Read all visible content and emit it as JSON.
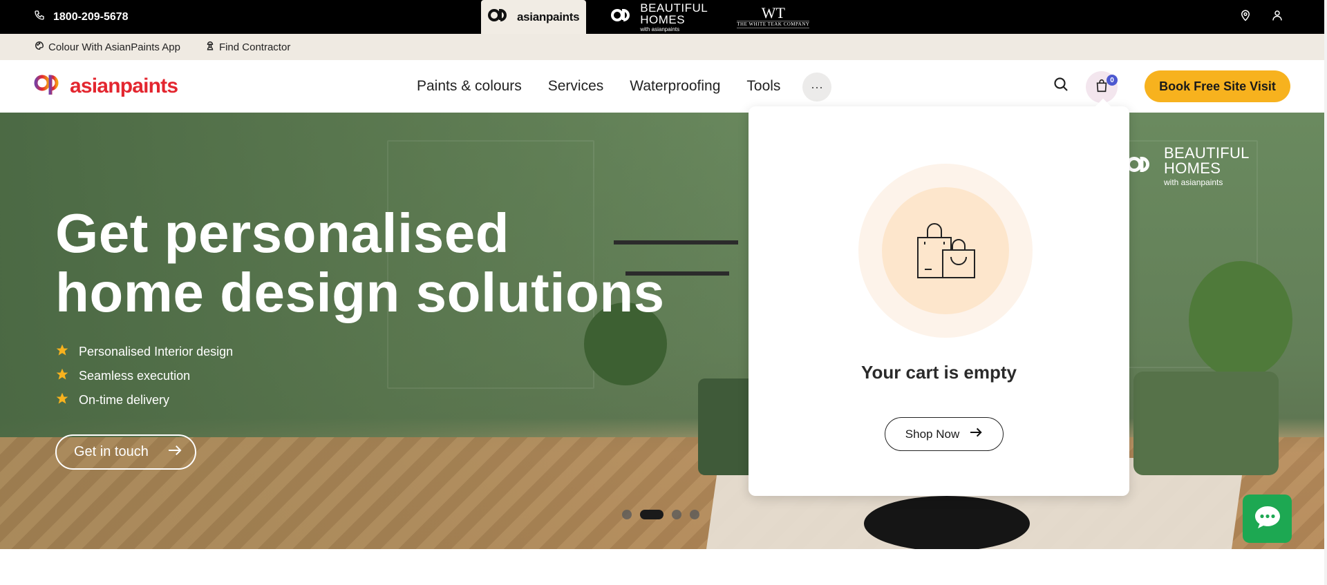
{
  "topbar": {
    "phone": "1800-209-5678",
    "brands": [
      {
        "name": "asianpaints",
        "active": true
      },
      {
        "name": "BEAUTIFUL HOMES",
        "line1": "BEAUTIFUL",
        "line2": "HOMES",
        "sub": "with asianpaints",
        "active": false
      },
      {
        "name": "THE WHITE TEAK COMPANY",
        "mono": "WT",
        "sub": "THE WHITE TEAK COMPANY",
        "active": false
      }
    ],
    "icons": [
      "location-icon",
      "user-icon"
    ]
  },
  "subbar": {
    "links": [
      "Colour With AsianPaints App",
      "Find Contractor"
    ]
  },
  "nav": {
    "logo_text": "asianpaints",
    "links": [
      "Paints & colours",
      "Services",
      "Waterproofing",
      "Tools"
    ],
    "more": "···",
    "cart_count": "0",
    "cta": "Book Free Site Visit"
  },
  "hero": {
    "title_line1": "Get personalised",
    "title_line2": "home design solutions",
    "bullets": [
      "Personalised Interior design",
      "Seamless execution",
      "On-time delivery"
    ],
    "cta": "Get in touch",
    "overlay_brand_line1": "BEAUTIFUL",
    "overlay_brand_line2": "HOMES",
    "overlay_brand_sub": "with asianpaints",
    "slides_total": 4,
    "active_slide": 2
  },
  "cart_popup": {
    "message": "Your cart is empty",
    "button": "Shop Now"
  },
  "colors": {
    "brand_red": "#e3262f",
    "cta_yellow": "#f7b21e",
    "badge_blue": "#4d59d0",
    "chat_green": "#1da852"
  }
}
